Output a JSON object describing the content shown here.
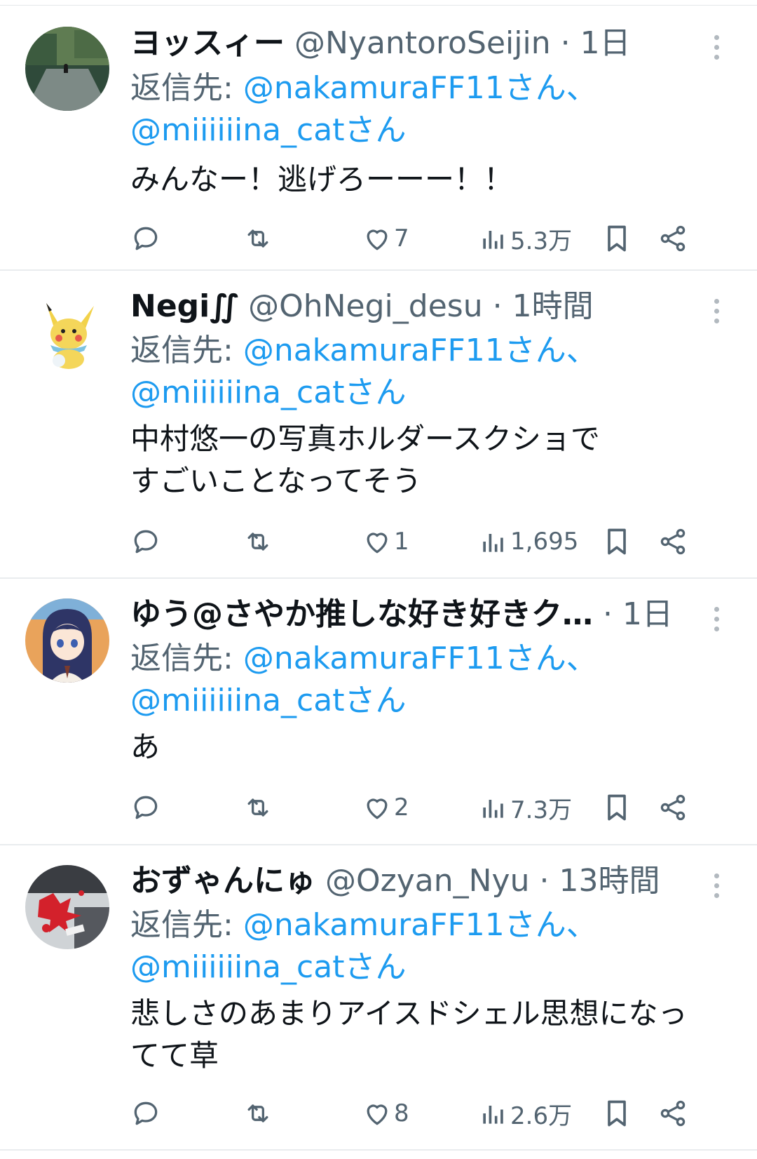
{
  "colors": {
    "link": "#1d9bf0",
    "secondary": "#536471",
    "divider": "#e9ecee"
  },
  "tweets": [
    {
      "name": "ヨッスィー",
      "handle": "@NyantoroSeijin",
      "separator": "·",
      "time": "1日",
      "reply_prefix": "返信先: ",
      "mention1": "@nakamuraFF11さん、",
      "mention2": "@miiiiiina_catさん",
      "text": "みんなー！逃げろーーー！！",
      "likes": "7",
      "views": "5.3万",
      "avatar_icon": "night-street-cat-avatar"
    },
    {
      "name": "Negi∬",
      "handle": "@OhNegi_desu",
      "separator": "·",
      "time": "1時間",
      "reply_prefix": "返信先: ",
      "mention1": "@nakamuraFF11さん、",
      "mention2": "@miiiiiina_catさん",
      "text": "中村悠一の写真ホルダースクショで\nすごいことなってそう",
      "likes": "1",
      "views": "1,695",
      "avatar_icon": "yellow-mouse-character-avatar"
    },
    {
      "name": "ゆう@さやか推しな好き好きク…",
      "handle": "",
      "separator": "·",
      "time": "1日",
      "reply_prefix": "返信先: ",
      "mention1": "@nakamuraFF11さん、",
      "mention2": "@miiiiiina_catさん",
      "text": "あ",
      "likes": "2",
      "views": "7.3万",
      "avatar_icon": "anime-girl-avatar"
    },
    {
      "name": "おずゃんにゅ",
      "handle": "@Ozyan_Nyu",
      "separator": "·",
      "time": "13時間",
      "reply_prefix": "返信先: ",
      "mention1": "@nakamuraFF11さん、",
      "mention2": "@miiiiiina_catさん",
      "text": "悲しさのあまりアイスドシェル思想になっ\nてて草",
      "likes": "8",
      "views": "2.6万",
      "avatar_icon": "red-splash-art-avatar"
    }
  ]
}
